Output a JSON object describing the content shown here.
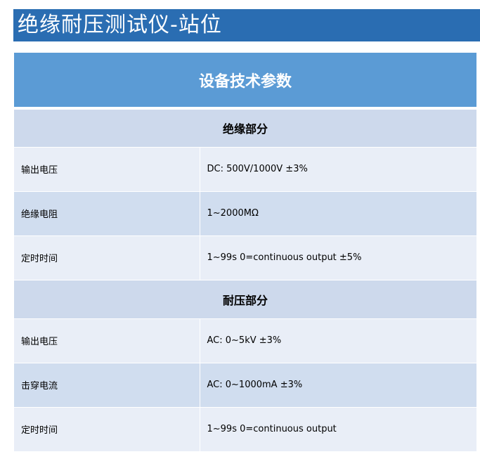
{
  "page_title": "绝缘耐压测试仪-站位",
  "table": {
    "header": "设备技术参数",
    "sections": [
      {
        "name": "绝缘部分",
        "rows": [
          {
            "label": "输出电压",
            "value": "DC: 500V/1000V ±3%"
          },
          {
            "label": "绝缘电阻",
            "value": "1~2000MΩ"
          },
          {
            "label": "定时时间",
            "value": "1~99s 0=continuous output ±5%"
          }
        ]
      },
      {
        "name": "耐压部分",
        "rows": [
          {
            "label": "输出电压",
            "value": "AC: 0~5kV ±3%"
          },
          {
            "label": "击穿电流",
            "value": "AC: 0~1000mA ±3%"
          },
          {
            "label": "定时时间",
            "value": "1~99s 0=continuous output"
          }
        ]
      }
    ]
  },
  "colors": {
    "title_bar": "#2a6db2",
    "table_header": "#5b9bd5",
    "section_row": "#cdd9ec",
    "row_light": "#e9eef7",
    "row_dark": "#d0ddef"
  }
}
